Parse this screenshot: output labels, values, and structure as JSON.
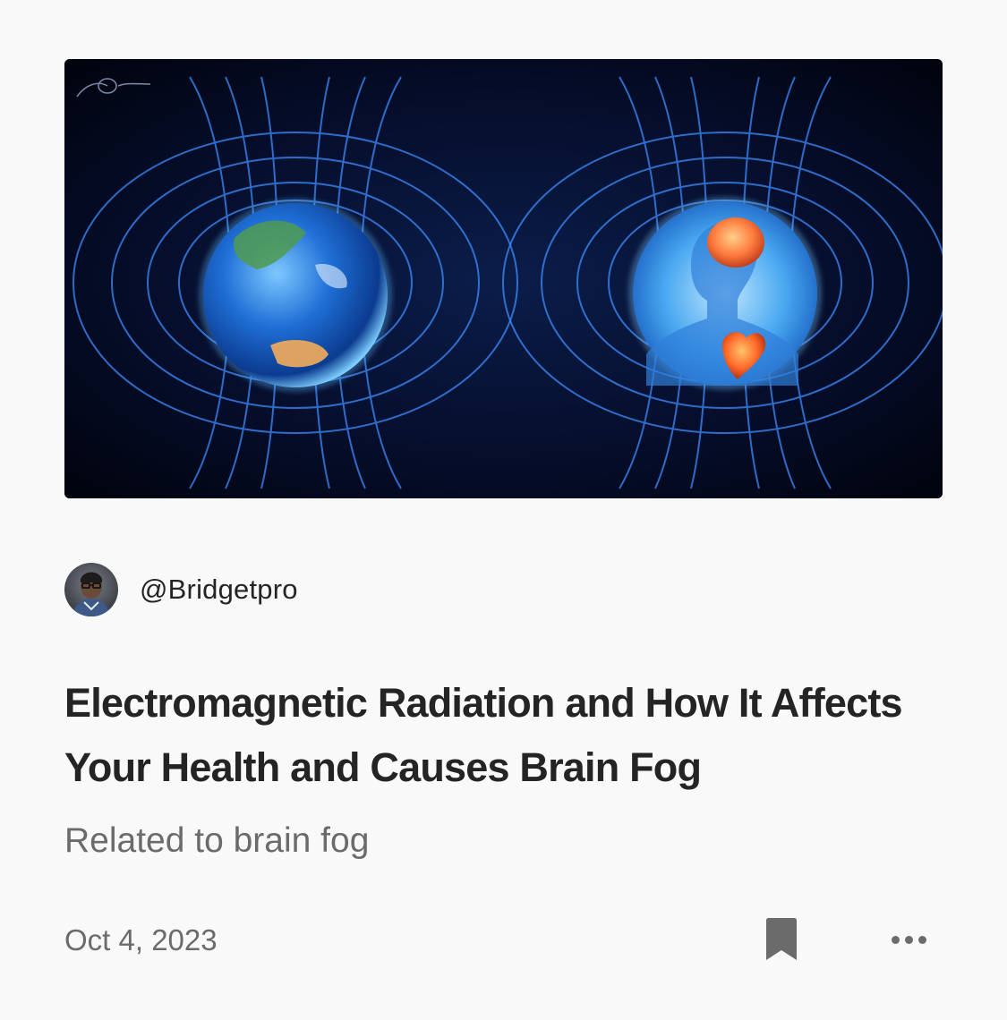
{
  "post": {
    "author_handle": "@Bridgetpro",
    "title": "Electromagnetic Radiation and How It Affects Your Health and Causes Brain Fog",
    "subtitle": "Related to brain fog",
    "date": "Oct 4, 2023"
  },
  "icons": {
    "bookmark": "bookmark-icon",
    "more": "more-horizontal-icon"
  },
  "colors": {
    "background": "#f9f9f9",
    "title": "#242424",
    "muted": "#6b6b6b",
    "hero_glow": "#3b82f6"
  }
}
